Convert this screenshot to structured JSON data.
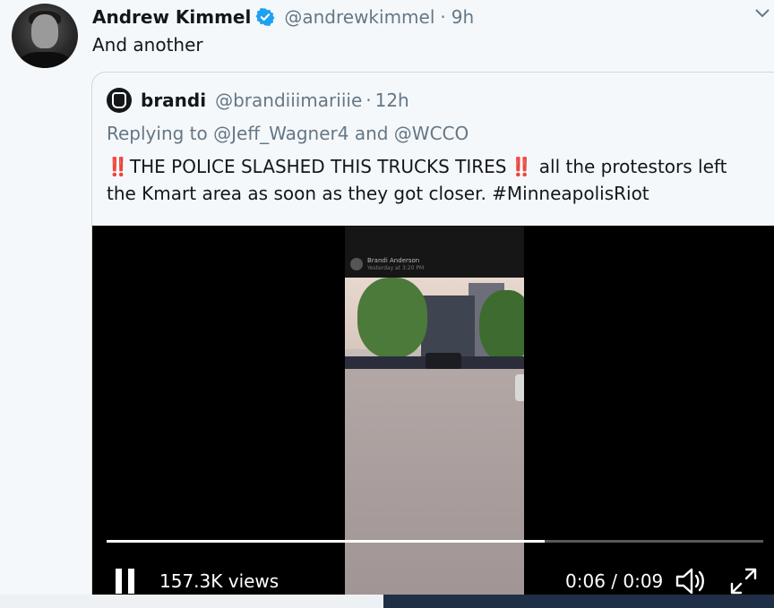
{
  "tweet": {
    "author_name": "Andrew Kimmel",
    "handle": "@andrewkimmel",
    "separator": "·",
    "time": "9h",
    "text": "And another"
  },
  "quoted_tweet": {
    "author_name": "brandi",
    "handle": "@brandiiimariiie",
    "separator": "·",
    "time": "12h",
    "replying_to": "Replying to @Jeff_Wagner4 and @WCCO",
    "emphasis": "‼️",
    "body_part1": "THE POLICE SLASHED THIS TRUCKS TIRES",
    "body_part2": " all the protestors left the Kmart area as soon as they got closer. #MinneapolisRiot"
  },
  "video": {
    "views": "157.3K views",
    "time_display": "0:06 / 0:09",
    "progress_fraction": 0.667,
    "embedded_author": "Brandi Anderson",
    "embedded_subtitle": "Yesterday at 3:20 PM"
  },
  "icons": {
    "verified": "verified-badge-icon",
    "caret": "chevron-down-icon",
    "pause": "pause-icon",
    "volume": "volume-icon",
    "fullscreen": "fullscreen-icon"
  },
  "colors": {
    "verified_blue": "#1da1f2",
    "secondary_text": "#657786",
    "emphasis_red": "#e0245e"
  }
}
